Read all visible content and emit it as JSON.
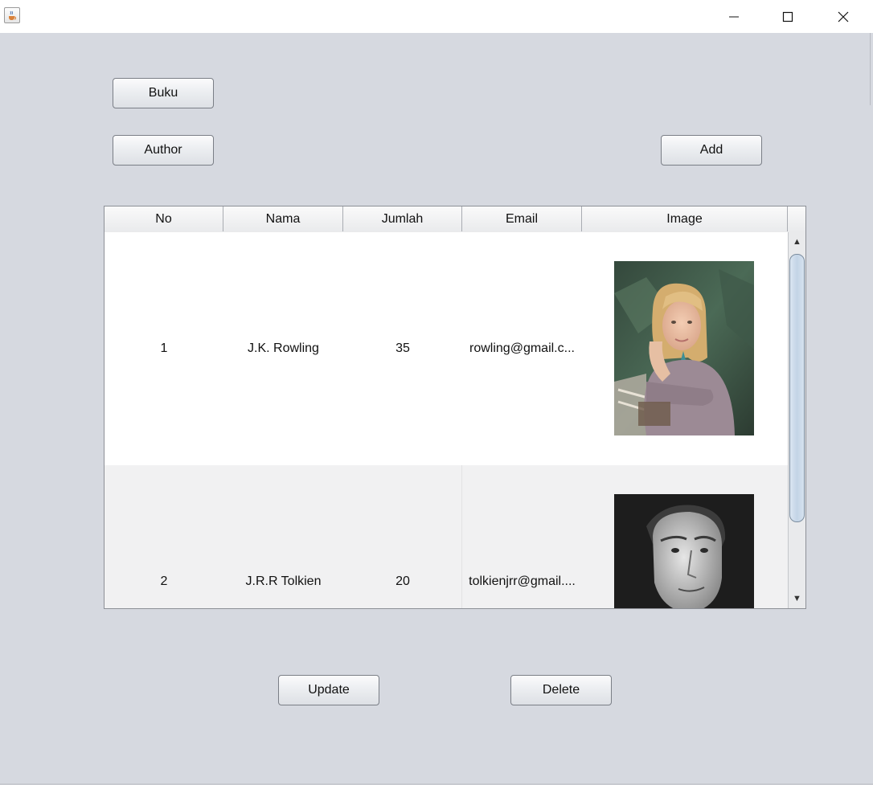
{
  "window": {
    "app_icon": "java-cup-icon",
    "controls": {
      "minimize": "minimize-icon",
      "maximize": "maximize-icon",
      "close": "close-icon"
    }
  },
  "nav": {
    "buku_label": "Buku",
    "author_label": "Author",
    "add_label": "Add"
  },
  "table": {
    "columns": [
      "No",
      "Nama",
      "Jumlah",
      "Email",
      "Image"
    ],
    "rows": [
      {
        "no": "1",
        "nama": "J.K. Rowling",
        "jumlah": "35",
        "email": "rowling@gmail.c...",
        "image": "author-photo-rowling"
      },
      {
        "no": "2",
        "nama": "J.R.R Tolkien",
        "jumlah": "20",
        "email": "tolkienjrr@gmail....",
        "image": "author-photo-tolkien"
      }
    ],
    "scroll": {
      "up": "scroll-up-icon",
      "down": "scroll-down-icon"
    }
  },
  "actions": {
    "update_label": "Update",
    "delete_label": "Delete"
  }
}
